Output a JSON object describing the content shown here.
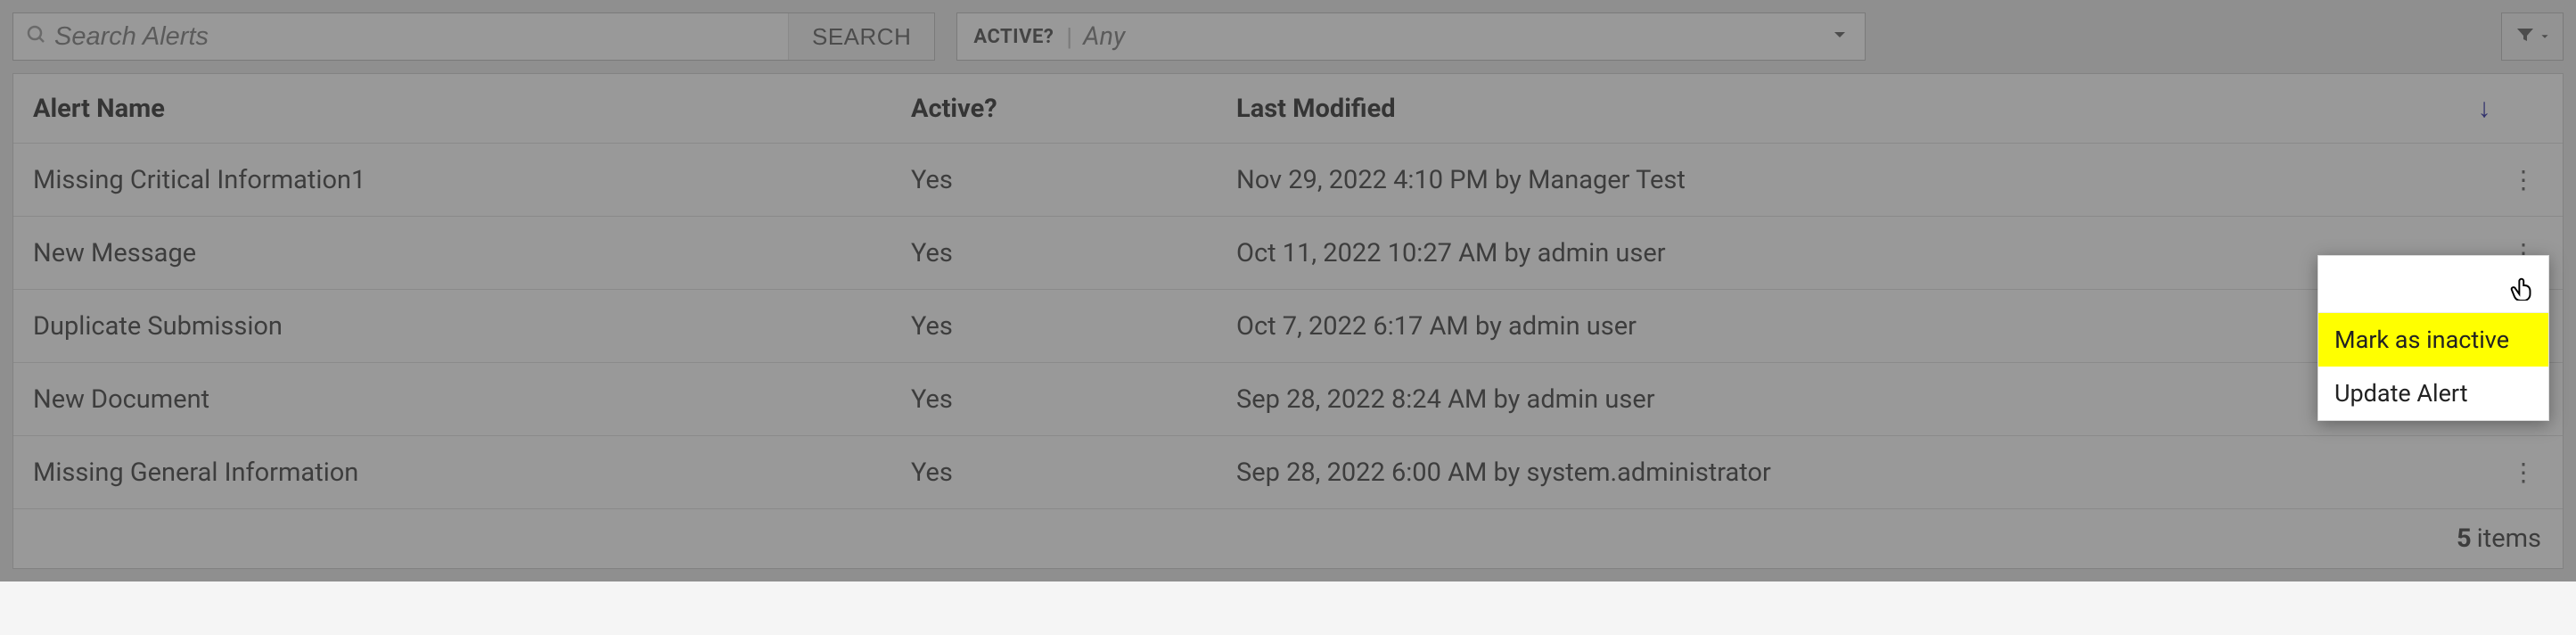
{
  "toolbar": {
    "search_placeholder": "Search Alerts",
    "search_button": "SEARCH",
    "active_filter_label": "ACTIVE?",
    "active_filter_value": "Any"
  },
  "columns": {
    "name": "Alert Name",
    "active": "Active?",
    "modified": "Last Modified"
  },
  "rows": [
    {
      "name": "Missing Critical Information1",
      "active": "Yes",
      "modified": "Nov 29, 2022 4:10 PM by Manager Test"
    },
    {
      "name": "New Message",
      "active": "Yes",
      "modified": "Oct 11, 2022 10:27 AM by admin user"
    },
    {
      "name": "Duplicate Submission",
      "active": "Yes",
      "modified": "Oct 7, 2022 6:17 AM by admin user"
    },
    {
      "name": "New Document",
      "active": "Yes",
      "modified": "Sep 28, 2022 8:24 AM by admin user"
    },
    {
      "name": "Missing General Information",
      "active": "Yes",
      "modified": "Sep 28, 2022 6:00 AM by system.administrator"
    }
  ],
  "footer": {
    "count": "5",
    "items_label": "items"
  },
  "context_menu": {
    "mark_inactive": "Mark as inactive",
    "update_alert": "Update Alert"
  }
}
